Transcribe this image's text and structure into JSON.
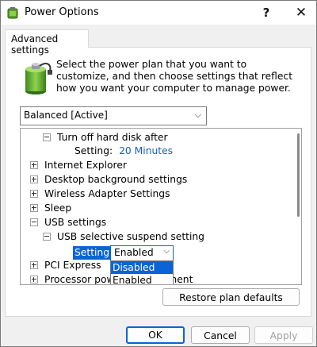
{
  "window": {
    "title": "Power Options",
    "help_glyph": "?",
    "close_glyph": "✕"
  },
  "tab": {
    "label": "Advanced settings"
  },
  "description": "Select the power plan that you want to customize, and then choose settings that reflect how you want your computer to manage power.",
  "plan": {
    "selected": "Balanced [Active]"
  },
  "tree": {
    "hard_disk": {
      "label": "Turn off hard disk after",
      "setting_label": "Setting:",
      "setting_value": "20 Minutes"
    },
    "items": [
      {
        "label": "Internet Explorer"
      },
      {
        "label": "Desktop background settings"
      },
      {
        "label": "Wireless Adapter Settings"
      },
      {
        "label": "Sleep"
      },
      {
        "label": "USB settings"
      }
    ],
    "usb_selective": {
      "label": "USB selective suspend setting",
      "setting_label": "Setting:",
      "value": "Enabled"
    },
    "pci": {
      "label": "PCI Express"
    },
    "processor": {
      "label": "Processor power management"
    }
  },
  "dropdown": {
    "options": [
      "Disabled",
      "Enabled"
    ],
    "highlighted": "Disabled"
  },
  "buttons": {
    "restore": "Restore plan defaults",
    "ok": "OK",
    "cancel": "Cancel",
    "apply": "Apply"
  },
  "icons": {
    "app": "power-options-icon",
    "battery": "battery-plan-icon"
  },
  "colors": {
    "accent": "#0a64d6",
    "setting_value": "#1a5fb4"
  }
}
